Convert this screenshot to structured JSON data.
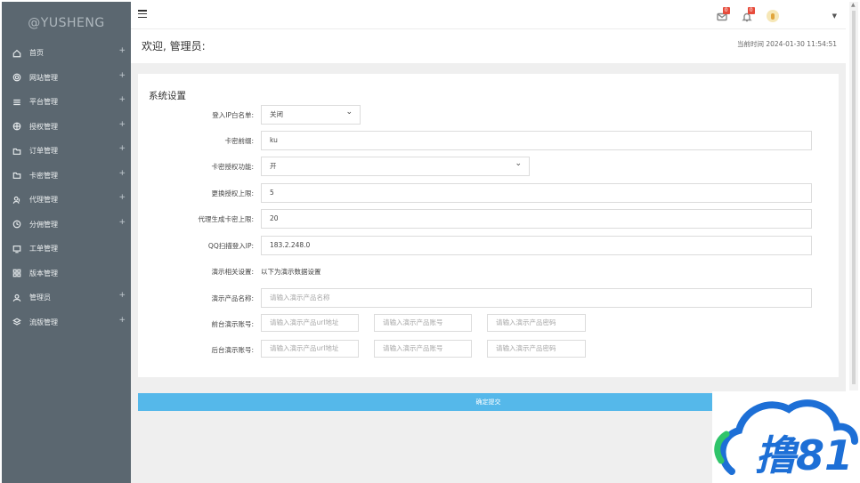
{
  "sidebar": {
    "brand": "@YUSHENG",
    "items": [
      {
        "label": "首页",
        "icon": "home-icon",
        "has_plus": true
      },
      {
        "label": "网站管理",
        "icon": "gear-icon",
        "has_plus": true
      },
      {
        "label": "平台管理",
        "icon": "menu-lines-icon",
        "has_plus": true
      },
      {
        "label": "授权管理",
        "icon": "flower-icon",
        "has_plus": true
      },
      {
        "label": "订单管理",
        "icon": "folder-icon",
        "has_plus": true
      },
      {
        "label": "卡密管理",
        "icon": "folder-icon",
        "has_plus": true
      },
      {
        "label": "代理管理",
        "icon": "user-group-icon",
        "has_plus": true
      },
      {
        "label": "分佣管理",
        "icon": "clock-icon",
        "has_plus": true
      },
      {
        "label": "工单管理",
        "icon": "monitor-icon",
        "has_plus": false
      },
      {
        "label": "版本管理",
        "icon": "grid-icon",
        "has_plus": false
      },
      {
        "label": "管理员",
        "icon": "user-icon",
        "has_plus": true
      },
      {
        "label": "流版管理",
        "icon": "layers-icon",
        "has_plus": true
      }
    ],
    "plus_symbol": "+"
  },
  "header": {
    "mail_badge": "0",
    "bell_badge": "0"
  },
  "welcome": {
    "text": "欢迎, 管理员:",
    "timestamp": "当前时间 2024-01-30 11:54:51"
  },
  "form": {
    "title": "系统设置",
    "ip_whitelist": {
      "label": "登入IP白名单:",
      "value": "关闭"
    },
    "card_prefix": {
      "label": "卡密前缀:",
      "value": "ku"
    },
    "card_auth": {
      "label": "卡密授权功能:",
      "value": "开"
    },
    "replace_limit": {
      "label": "更换授权上限:",
      "value": "5"
    },
    "agent_limit": {
      "label": "代理生成卡密上限:",
      "value": "20"
    },
    "qq_ip": {
      "label": "QQ扫描登入IP:",
      "value": "183.2.248.0"
    },
    "demo_settings": {
      "label": "演示相关设置:",
      "value": "以下为演示数据设置"
    },
    "demo_name": {
      "label": "演示产品名称:",
      "placeholder": "请输入演示产品名称"
    },
    "front_demo": {
      "label": "前台演示账号:",
      "url_placeholder": "请输入演示产品url地址",
      "account_placeholder": "请输入演示产品账号",
      "password_placeholder": "请输入演示产品密码"
    },
    "back_demo": {
      "label": "后台演示账号:",
      "url_placeholder": "请输入演示产品url地址",
      "account_placeholder": "请输入演示产品账号",
      "password_placeholder": "请输入演示产品密码"
    },
    "submit": "确定提交"
  },
  "watermark": {
    "text": "撸81"
  },
  "colors": {
    "sidebar": "#5b6770",
    "submit": "#55b8ea",
    "badge": "#e74c3c",
    "watermark_blue": "#1d6fd6",
    "watermark_green": "#2fc46a"
  }
}
